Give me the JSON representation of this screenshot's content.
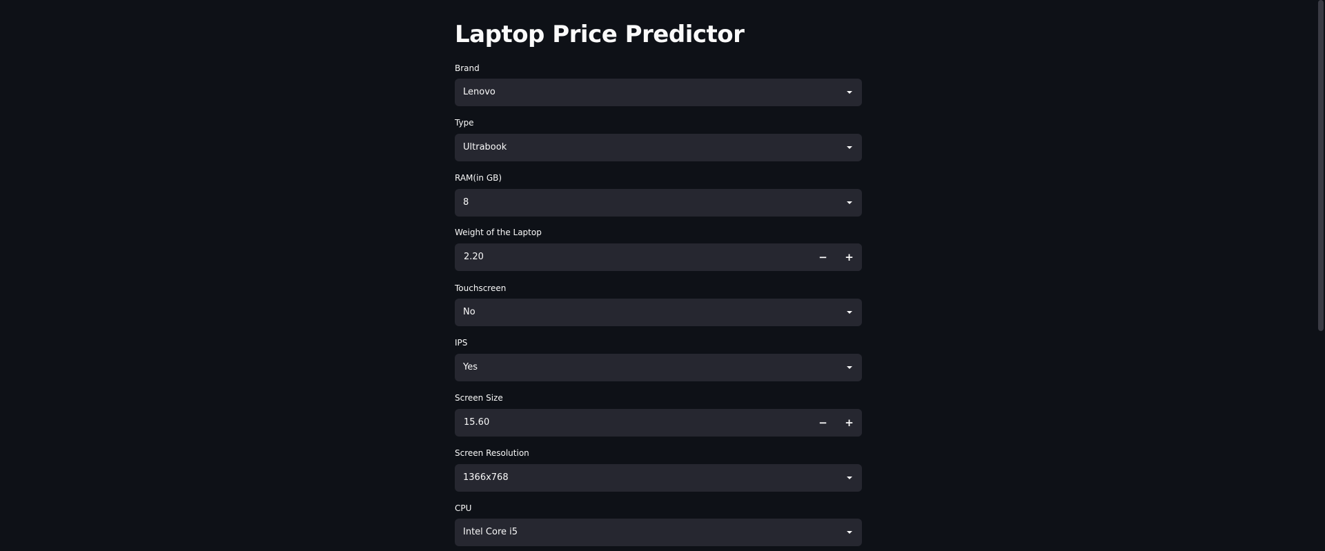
{
  "page": {
    "title": "Laptop Price Predictor"
  },
  "form": {
    "brand": {
      "label": "Brand",
      "value": "Lenovo"
    },
    "type": {
      "label": "Type",
      "value": "Ultrabook"
    },
    "ram": {
      "label": "RAM(in GB)",
      "value": "8"
    },
    "weight": {
      "label": "Weight of the Laptop",
      "value": "2.20",
      "minus": "−",
      "plus": "+"
    },
    "touchscreen": {
      "label": "Touchscreen",
      "value": "No"
    },
    "ips": {
      "label": "IPS",
      "value": "Yes"
    },
    "screen_size": {
      "label": "Screen Size",
      "value": "15.60",
      "minus": "−",
      "plus": "+"
    },
    "resolution": {
      "label": "Screen Resolution",
      "value": "1366x768"
    },
    "cpu": {
      "label": "CPU",
      "value": "Intel Core i5"
    }
  },
  "colors": {
    "background": "#0e1117",
    "input_background": "#262730",
    "text": "#fafafa"
  }
}
